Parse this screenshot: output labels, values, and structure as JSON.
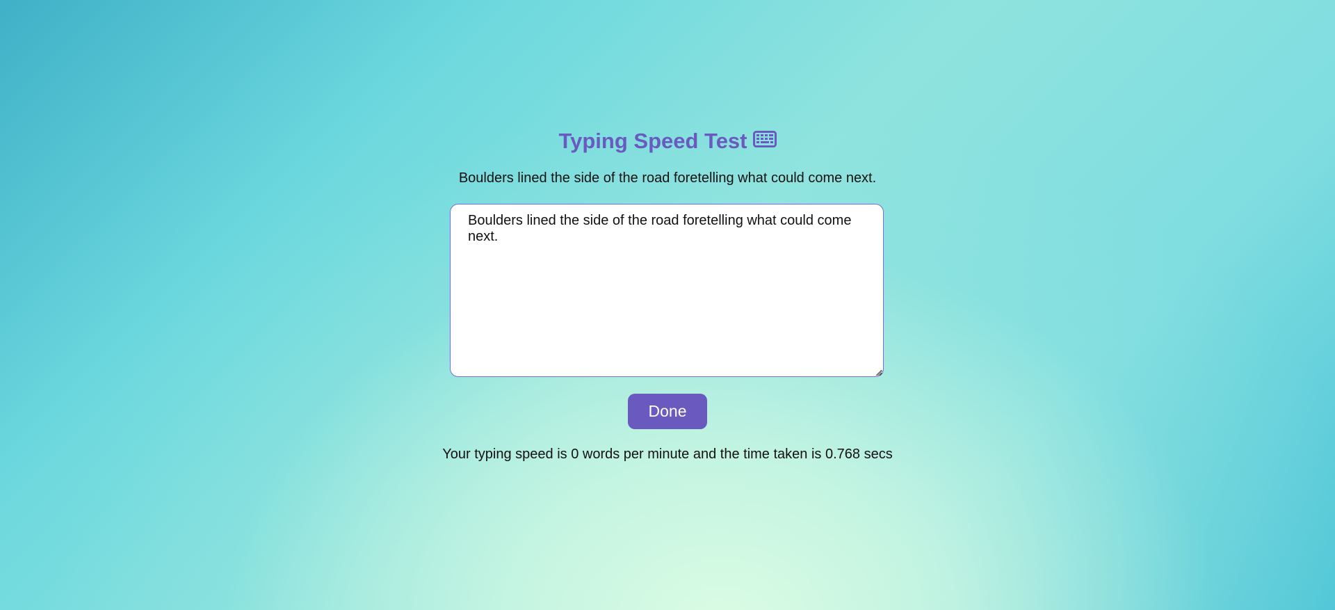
{
  "header": {
    "title": "Typing Speed Test",
    "title_icon": "keyboard-icon"
  },
  "test": {
    "sentence": "Boulders lined the side of the road foretelling what could come next.",
    "input_value": "Boulders lined the side of the road foretelling what could come next.",
    "done_label": "Done",
    "result": "Your typing speed is 0 words per minute and the time taken is 0.768 secs"
  },
  "colors": {
    "accent": "#6a5ac0",
    "text": "#111111",
    "background_gradient": [
      "#3fb0c7",
      "#8fe3de",
      "#dbfce3"
    ]
  }
}
